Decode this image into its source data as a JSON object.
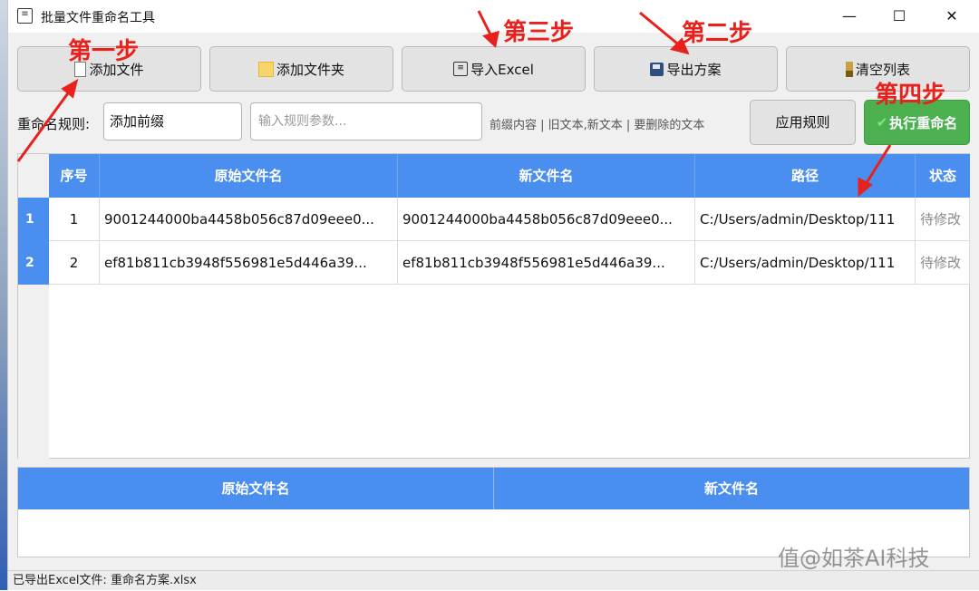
{
  "window": {
    "title": "批量文件重命名工具",
    "controls": {
      "minimize": "—",
      "maximize": "☐",
      "close": "✕"
    }
  },
  "toolbar": {
    "add_file": "添加文件",
    "add_folder": "添加文件夹",
    "import_excel": "导入Excel",
    "export_plan": "导出方案",
    "clear_list": "清空列表"
  },
  "rule": {
    "label": "重命名规则:",
    "selected": "添加前缀",
    "param_placeholder": "输入规则参数...",
    "hint": "前缀内容 | 旧文本,新文本 | 要删除的文本",
    "apply": "应用规则",
    "execute": "执行重命名"
  },
  "table": {
    "columns": [
      "序号",
      "原始文件名",
      "新文件名",
      "路径",
      "状态"
    ],
    "rows": [
      {
        "row_num": "1",
        "index": "1",
        "original": "9001244000ba4458b056c87d09eee0...",
        "new": "9001244000ba4458b056c87d09eee0...",
        "path": "C:/Users/admin/Desktop/111",
        "status": "待修改"
      },
      {
        "row_num": "2",
        "index": "2",
        "original": "ef81b811cb3948f556981e5d446a39...",
        "new": "ef81b811cb3948f556981e5d446a39...",
        "path": "C:/Users/admin/Desktop/111",
        "status": "待修改"
      }
    ]
  },
  "preview": {
    "columns": [
      "原始文件名",
      "新文件名"
    ]
  },
  "status_bar": "已导出Excel文件: 重命名方案.xlsx",
  "annotations": {
    "step1": "第一步",
    "step2": "第二步",
    "step3": "第三步",
    "step4": "第四步",
    "color": "#e8211c"
  },
  "watermark": "值@如茶AI科技",
  "colors": {
    "header_blue": "#4a8ef0",
    "execute_green": "#4caf50"
  }
}
